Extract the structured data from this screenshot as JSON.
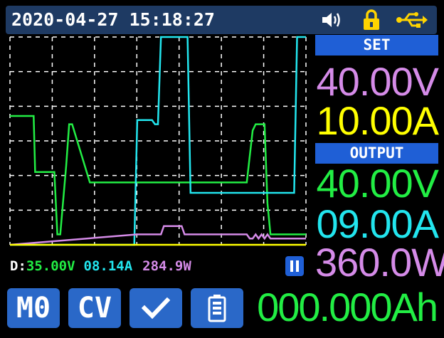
{
  "status_bar": {
    "datetime": "2020-04-27 15:18:27",
    "icons": [
      "speaker-icon",
      "lock-icon",
      "usb-icon"
    ],
    "icon_color_lock": "#ffd400",
    "icon_color_usb": "#ffd400"
  },
  "set": {
    "header": "SET",
    "voltage": "40.00V",
    "current": "10.00A"
  },
  "output": {
    "header": "OUTPUT",
    "voltage": "40.00V",
    "current": "09.00A",
    "power": "360.0W"
  },
  "chart_readout": {
    "label": "D:",
    "voltage": "35.00V",
    "current": "08.14A",
    "power": "284.9W"
  },
  "buttons": {
    "memory": "M0",
    "mode": "CV",
    "confirm_icon": "check-icon",
    "battery_icon": "battery-icon"
  },
  "capacity": "000.000Ah",
  "colors": {
    "voltage": "#22ee44",
    "current": "#22e5ee",
    "power": "#d58be8",
    "set_current": "#ffff00",
    "header_bg": "#1f5fd6",
    "status_bg": "#1e3a63",
    "button_bg": "#2a68c8"
  },
  "chart_data": {
    "type": "line",
    "grid": true,
    "series": [
      {
        "color": "#22ee44",
        "x": [
          0,
          8,
          8.5,
          15,
          16,
          17,
          19,
          20,
          21,
          27,
          28,
          29,
          30,
          80,
          82,
          83,
          86,
          87,
          88,
          89,
          100
        ],
        "values": [
          0.62,
          0.62,
          0.35,
          0.35,
          0.05,
          0.05,
          0.38,
          0.58,
          0.58,
          0.3,
          0.3,
          0.3,
          0.3,
          0.3,
          0.55,
          0.58,
          0.58,
          0.2,
          0.05,
          0.05,
          0.05
        ]
      },
      {
        "color": "#22e5ee",
        "x": [
          0,
          42,
          43,
          48,
          49,
          50,
          51,
          52,
          60,
          61,
          96,
          97,
          100
        ],
        "values": [
          0.0,
          0.0,
          0.6,
          0.6,
          0.58,
          0.58,
          1.0,
          1.0,
          1.0,
          0.25,
          0.25,
          1.0,
          1.0
        ],
        "note_skip": true
      },
      {
        "color": "#d58be8",
        "x": [
          0,
          43,
          51,
          52,
          58,
          59,
          62,
          63,
          80,
          81,
          82,
          83,
          84,
          85,
          86,
          87,
          88,
          89,
          100
        ],
        "values": [
          0.0,
          0.05,
          0.05,
          0.09,
          0.09,
          0.05,
          0.05,
          0.05,
          0.05,
          0.03,
          0.03,
          0.05,
          0.03,
          0.05,
          0.03,
          0.05,
          0.03,
          0.03,
          0.03
        ]
      },
      {
        "color": "#ffff00",
        "x": [
          0,
          100
        ],
        "values": [
          0.0,
          0.0
        ]
      }
    ]
  }
}
